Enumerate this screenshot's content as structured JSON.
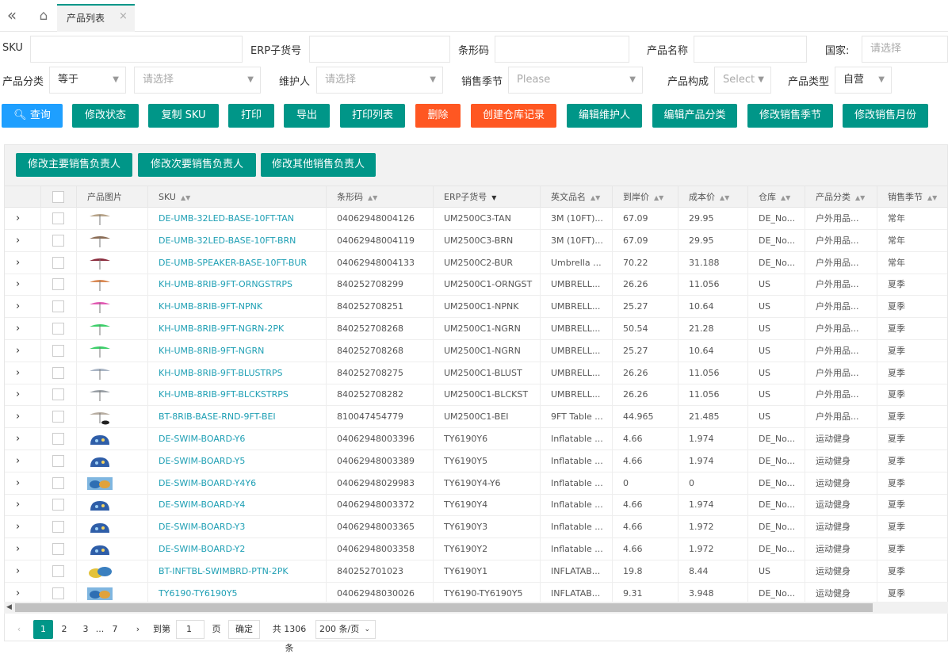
{
  "tabbar": {
    "collapse_icon": "double-chevron-left",
    "home_icon": "home",
    "tab_label": "产品列表",
    "tab_close": "×"
  },
  "filters": {
    "sku_label": "SKU",
    "erp_label": "ERP子货号",
    "barcode_label": "条形码",
    "name_label": "产品名称",
    "country_label": "国家:",
    "country_placeholder": "请选择",
    "category_label": "产品分类",
    "category_op": "等于",
    "category_placeholder": "请选择",
    "maintainer_label": "维护人",
    "maintainer_placeholder": "请选择",
    "season_label": "销售季节",
    "season_placeholder": "Please",
    "composition_label": "产品构成",
    "composition_placeholder": "Select",
    "type_label": "产品类型",
    "type_value": "自营"
  },
  "toolbar": {
    "query": "查询",
    "edit_status": "修改状态",
    "copy_sku": "复制 SKU",
    "print": "打印",
    "export": "导出",
    "print_list": "打印列表",
    "delete": "删除",
    "create_wh": "创建仓库记录",
    "edit_maint": "编辑维护人",
    "edit_cat": "编辑产品分类",
    "edit_season": "修改销售季节",
    "edit_month": "修改销售月份"
  },
  "panel_buttons": {
    "primary": "修改主要销售负责人",
    "secondary": "修改次要销售负责人",
    "other": "修改其他销售负责人"
  },
  "columns": [
    "产品图片",
    "SKU",
    "条形码",
    "ERP子货号",
    "英文品名",
    "到岸价",
    "成本价",
    "仓库",
    "产品分类",
    "销售季节"
  ],
  "rows": [
    {
      "sku": "DE-UMB-32LED-BASE-10FT-TAN",
      "barcode": "04062948004126",
      "erp": "UM2500C3-TAN",
      "en": "3M (10FT)...",
      "landed": "67.09",
      "cost": "29.95",
      "wh": "DE_No...",
      "cat": "户外用品...",
      "season": "常年",
      "img": "umbrella-tan"
    },
    {
      "sku": "DE-UMB-32LED-BASE-10FT-BRN",
      "barcode": "04062948004119",
      "erp": "UM2500C3-BRN",
      "en": "3M (10FT)...",
      "landed": "67.09",
      "cost": "29.95",
      "wh": "DE_No...",
      "cat": "户外用品...",
      "season": "常年",
      "img": "umbrella-brown"
    },
    {
      "sku": "DE-UMB-SPEAKER-BASE-10FT-BUR",
      "barcode": "04062948004133",
      "erp": "UM2500C2-BUR",
      "en": "Umbrella ...",
      "landed": "70.22",
      "cost": "31.188",
      "wh": "DE_No...",
      "cat": "户外用品...",
      "season": "常年",
      "img": "umbrella-burgundy"
    },
    {
      "sku": "KH-UMB-8RIB-9FT-ORNGSTRPS",
      "barcode": "840252708299",
      "erp": "UM2500C1-ORNGST",
      "en": "UMBRELL...",
      "landed": "26.26",
      "cost": "11.056",
      "wh": "US",
      "cat": "户外用品...",
      "season": "夏季",
      "img": "umbrella-orange"
    },
    {
      "sku": "KH-UMB-8RIB-9FT-NPNK",
      "barcode": "840252708251",
      "erp": "UM2500C1-NPNK",
      "en": "UMBRELL...",
      "landed": "25.27",
      "cost": "10.64",
      "wh": "US",
      "cat": "户外用品...",
      "season": "夏季",
      "img": "umbrella-pink"
    },
    {
      "sku": "KH-UMB-8RIB-9FT-NGRN-2PK",
      "barcode": "840252708268",
      "erp": "UM2500C1-NGRN",
      "en": "UMBRELL...",
      "landed": "50.54",
      "cost": "21.28",
      "wh": "US",
      "cat": "户外用品...",
      "season": "夏季",
      "img": "umbrella-green"
    },
    {
      "sku": "KH-UMB-8RIB-9FT-NGRN",
      "barcode": "840252708268",
      "erp": "UM2500C1-NGRN",
      "en": "UMBRELL...",
      "landed": "25.27",
      "cost": "10.64",
      "wh": "US",
      "cat": "户外用品...",
      "season": "夏季",
      "img": "umbrella-green"
    },
    {
      "sku": "KH-UMB-8RIB-9FT-BLUSTRPS",
      "barcode": "840252708275",
      "erp": "UM2500C1-BLUST",
      "en": "UMBRELL...",
      "landed": "26.26",
      "cost": "11.056",
      "wh": "US",
      "cat": "户外用品...",
      "season": "夏季",
      "img": "umbrella-bluestripe"
    },
    {
      "sku": "KH-UMB-8RIB-9FT-BLCKSTRPS",
      "barcode": "840252708282",
      "erp": "UM2500C1-BLCKST",
      "en": "UMBRELL...",
      "landed": "26.26",
      "cost": "11.056",
      "wh": "US",
      "cat": "户外用品...",
      "season": "夏季",
      "img": "umbrella-blackstripe"
    },
    {
      "sku": "BT-8RIB-BASE-RND-9FT-BEI",
      "barcode": "810047454779",
      "erp": "UM2500C1-BEI",
      "en": "9FT Table ...",
      "landed": "44.965",
      "cost": "21.485",
      "wh": "US",
      "cat": "户外用品...",
      "season": "夏季",
      "img": "umbrella-base"
    },
    {
      "sku": "DE-SWIM-BOARD-Y6",
      "barcode": "04062948003396",
      "erp": "TY6190Y6",
      "en": "Inflatable ...",
      "landed": "4.66",
      "cost": "1.974",
      "wh": "DE_No...",
      "cat": "运动健身",
      "season": "夏季",
      "img": "board"
    },
    {
      "sku": "DE-SWIM-BOARD-Y5",
      "barcode": "04062948003389",
      "erp": "TY6190Y5",
      "en": "Inflatable ...",
      "landed": "4.66",
      "cost": "1.974",
      "wh": "DE_No...",
      "cat": "运动健身",
      "season": "夏季",
      "img": "board"
    },
    {
      "sku": "DE-SWIM-BOARD-Y4Y6",
      "barcode": "04062948029983",
      "erp": "TY6190Y4-Y6",
      "en": "Inflatable ...",
      "landed": "0",
      "cost": "0",
      "wh": "DE_No...",
      "cat": "运动健身",
      "season": "夏季",
      "img": "board-pack"
    },
    {
      "sku": "DE-SWIM-BOARD-Y4",
      "barcode": "04062948003372",
      "erp": "TY6190Y4",
      "en": "Inflatable ...",
      "landed": "4.66",
      "cost": "1.974",
      "wh": "DE_No...",
      "cat": "运动健身",
      "season": "夏季",
      "img": "board"
    },
    {
      "sku": "DE-SWIM-BOARD-Y3",
      "barcode": "04062948003365",
      "erp": "TY6190Y3",
      "en": "Inflatable ...",
      "landed": "4.66",
      "cost": "1.972",
      "wh": "DE_No...",
      "cat": "运动健身",
      "season": "夏季",
      "img": "board"
    },
    {
      "sku": "DE-SWIM-BOARD-Y2",
      "barcode": "04062948003358",
      "erp": "TY6190Y2",
      "en": "Inflatable ...",
      "landed": "4.66",
      "cost": "1.972",
      "wh": "DE_No...",
      "cat": "运动健身",
      "season": "夏季",
      "img": "board"
    },
    {
      "sku": "BT-INFTBL-SWIMBRD-PTN-2PK",
      "barcode": "840252701023",
      "erp": "TY6190Y1",
      "en": "INFLATAB...",
      "landed": "19.8",
      "cost": "8.44",
      "wh": "US",
      "cat": "运动健身",
      "season": "夏季",
      "img": "board-yellow"
    },
    {
      "sku": "TY6190-TY6190Y5",
      "barcode": "04062948030026",
      "erp": "TY6190-TY6190Y5",
      "en": "INFLATAB...",
      "landed": "9.31",
      "cost": "3.948",
      "wh": "DE_No...",
      "cat": "运动健身",
      "season": "夏季",
      "img": "board-pack"
    }
  ],
  "pager": {
    "p1": "1",
    "p2": "2",
    "p3": "3",
    "ellipsis": "...",
    "p7": "7",
    "goto": "到第",
    "page_input": "1",
    "page_unit": "页",
    "confirm": "确定",
    "total": "共 1306 条",
    "page_size": "200 条/页"
  },
  "colors": {
    "teal": "#009688",
    "orange": "#ff5722",
    "blue": "#1e9fff",
    "link": "#1e9fb4"
  }
}
